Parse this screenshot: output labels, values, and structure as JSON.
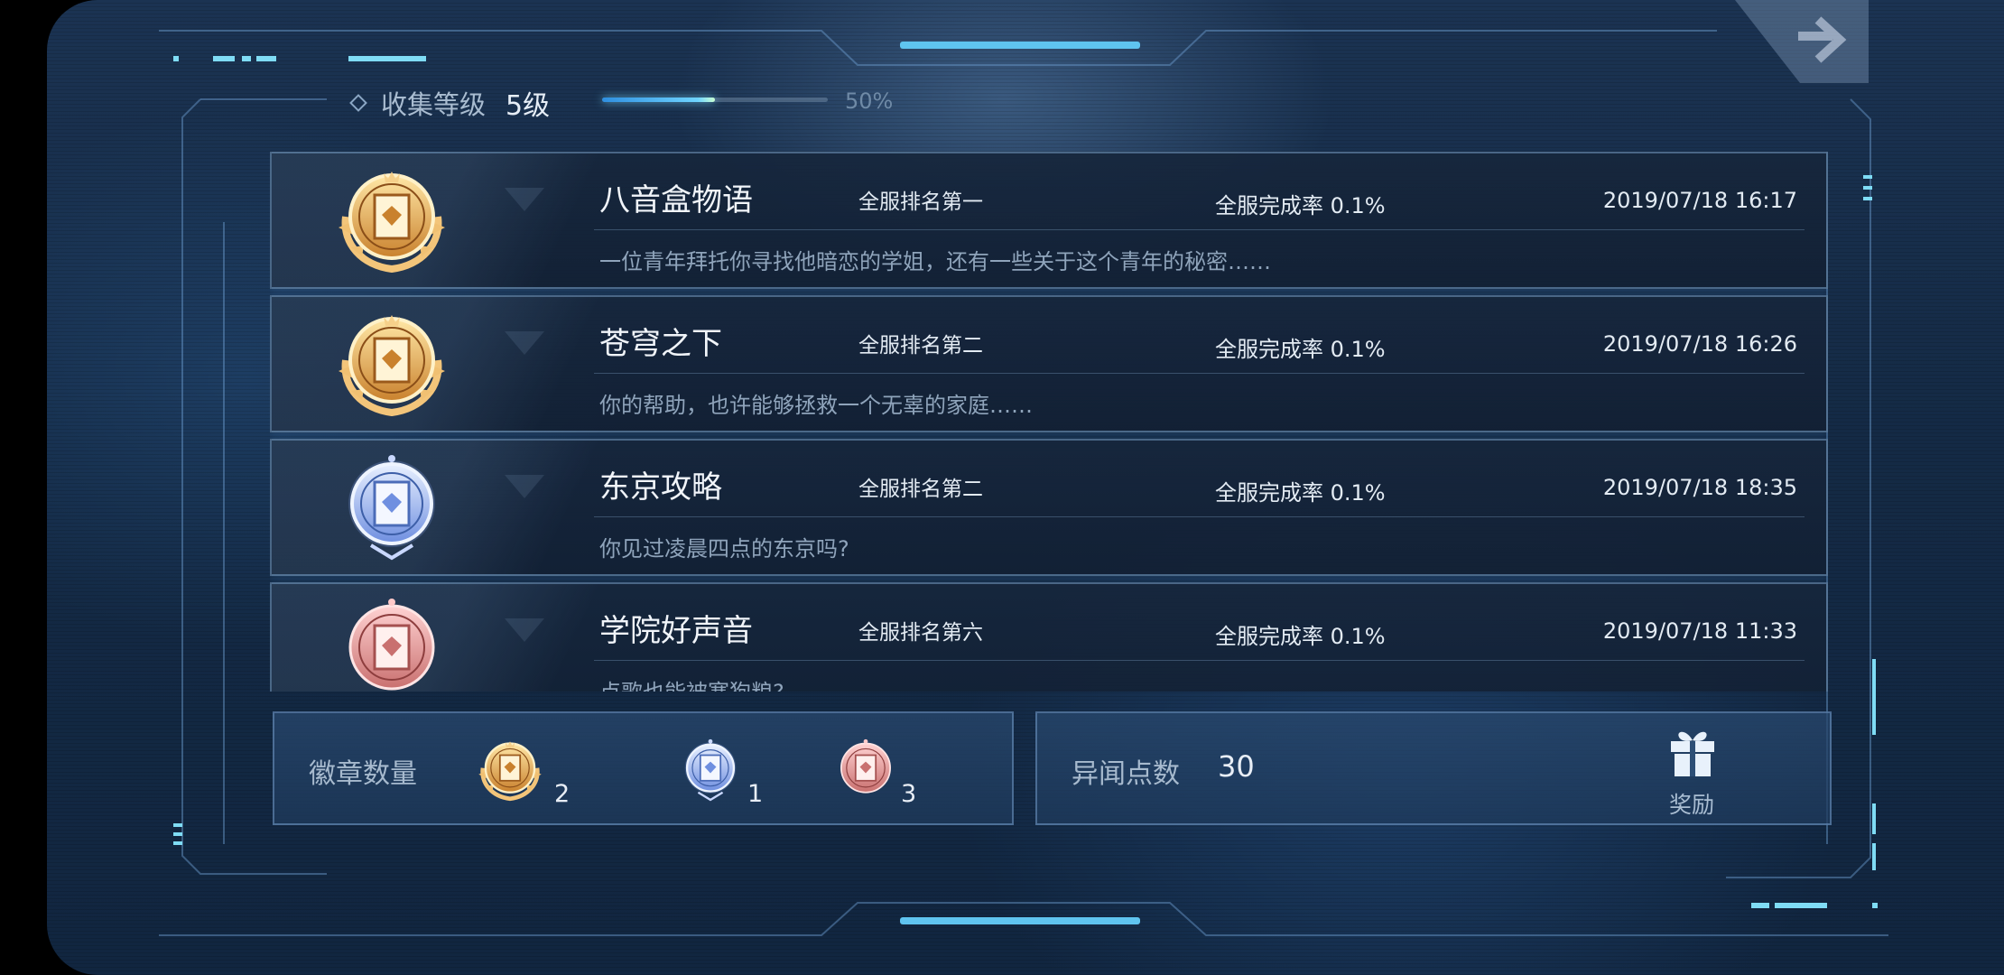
{
  "header": {
    "level_label": "收集等级",
    "level_value": "5级",
    "progress": 0.5,
    "progress_text": "50%"
  },
  "entries": [
    {
      "title": "八音盒物语",
      "rank": "全服排名第一",
      "completion_rate": "全服完成率 0.1%",
      "date": "2019/07/18 16:17",
      "description": "一位青年拜托你寻找他暗恋的学姐，还有一些关于这个青年的秘密……",
      "badge": "gold"
    },
    {
      "title": "苍穹之下",
      "rank": "全服排名第二",
      "completion_rate": "全服完成率 0.1%",
      "date": "2019/07/18 16:26",
      "description": "你的帮助，也许能够拯救一个无辜的家庭……",
      "badge": "gold"
    },
    {
      "title": "东京攻略",
      "rank": "全服排名第二",
      "completion_rate": "全服完成率 0.1%",
      "date": "2019/07/18 18:35",
      "description": "你见过凌晨四点的东京吗?",
      "badge": "silver"
    },
    {
      "title": "学院好声音",
      "rank": "全服排名第六",
      "completion_rate": "全服完成率 0.1%",
      "date": "2019/07/18 11:33",
      "description": "点歌也能被塞狗粮?",
      "badge": "bronze"
    }
  ],
  "badge_summary": {
    "label": "徽章数量",
    "gold_count": "2",
    "silver_count": "1",
    "bronze_count": "3"
  },
  "points": {
    "label": "异闻点数",
    "value": "30",
    "reward_label": "奖励"
  },
  "colors": {
    "accent": "#6fd4ff",
    "gold": "#e8b560",
    "silver": "#8fb4ff",
    "bronze": "#e39a9a"
  }
}
